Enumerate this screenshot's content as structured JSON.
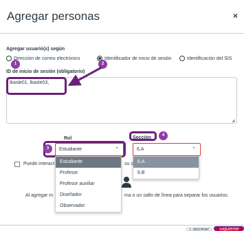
{
  "dialog": {
    "title": "Agregar personas",
    "close_label": "×"
  },
  "form": {
    "add_by_label": "Agregar usuario(s) según",
    "radio_options": [
      {
        "label": "Dirección de correo electrónico",
        "checked": false
      },
      {
        "label": "Identificador de inicio de sesión",
        "checked": true
      },
      {
        "label": "Identificación del SIS",
        "checked": false
      }
    ],
    "login_id_label": "ID de inicio de sesión (obligatorio)",
    "login_id_value": "lkasle01, lkasle03,",
    "role_label": "Rol",
    "role_selected": "Estudiante",
    "role_options": [
      "Estudiante",
      "Profesor",
      "Profesor auxiliar",
      "Diseñador",
      "Observador"
    ],
    "section_label": "Sección",
    "section_selected": "6.A",
    "section_options": [
      "6.A",
      "6.B"
    ],
    "interact_checkbox_label_start": "Puede interact",
    "interact_checkbox_label_end": "su s",
    "info_text_start": "Al agregar m",
    "info_text_end": "ma o un salto de línea para separar los usuarios."
  },
  "callouts": [
    "1",
    "2",
    "3",
    "4"
  ],
  "footer": {
    "cancel_label": "Cancelar",
    "next_label": "Siguiente"
  },
  "colors": {
    "highlight": "#6b1f79",
    "badge": "#8f3ea4",
    "primary_button": "#c0003c",
    "invalid_border": "#d33a3a"
  }
}
